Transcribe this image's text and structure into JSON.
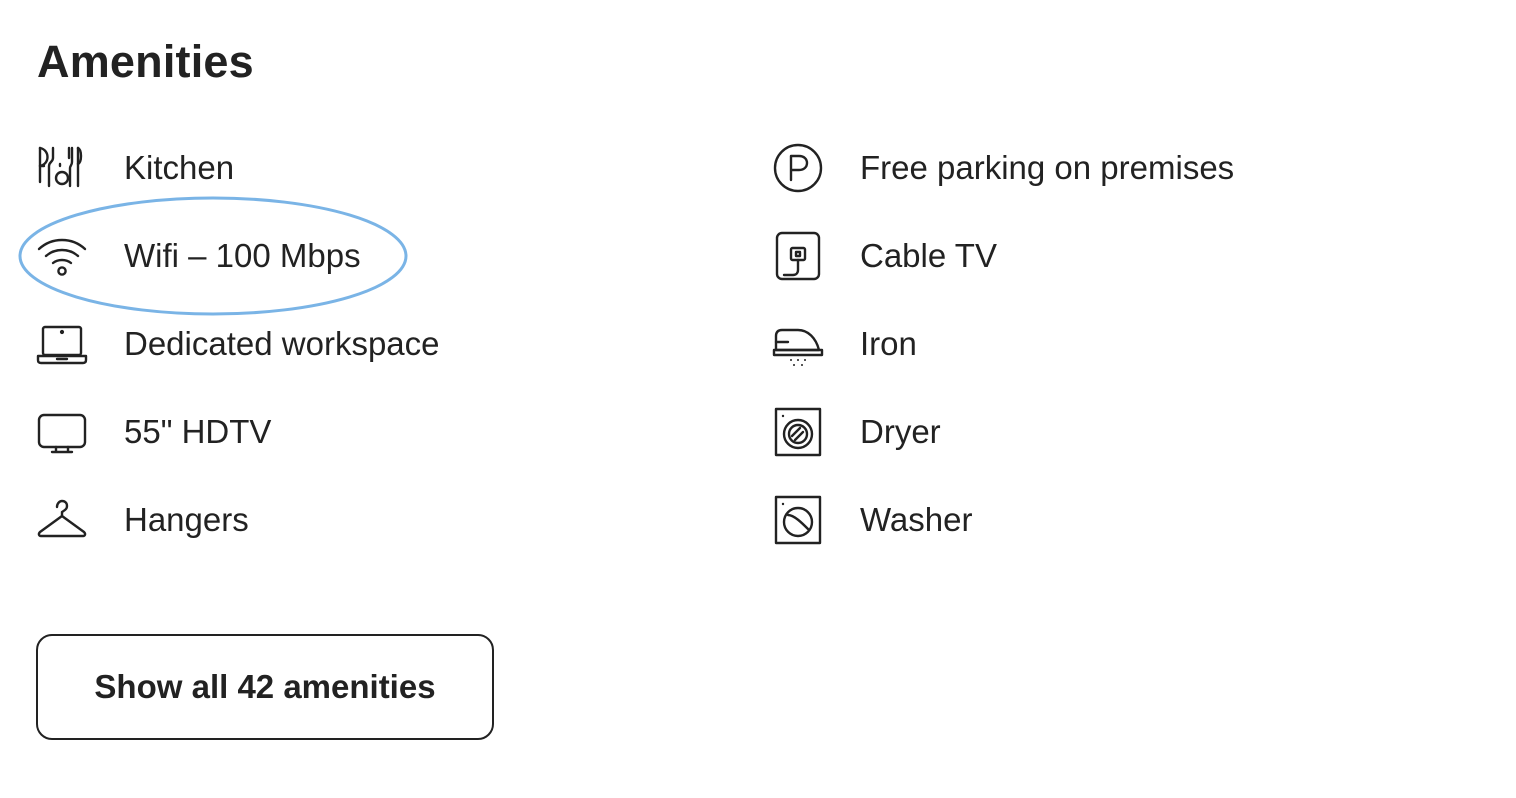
{
  "section": {
    "title": "Amenities"
  },
  "amenities": {
    "left": [
      {
        "label": "Kitchen",
        "icon": "kitchen-icon"
      },
      {
        "label": "Wifi – 100 Mbps",
        "icon": "wifi-icon"
      },
      {
        "label": "Dedicated workspace",
        "icon": "laptop-icon"
      },
      {
        "label": "55\" HDTV",
        "icon": "tv-icon"
      },
      {
        "label": "Hangers",
        "icon": "hanger-icon"
      }
    ],
    "right": [
      {
        "label": "Free parking on premises",
        "icon": "parking-icon"
      },
      {
        "label": "Cable TV",
        "icon": "cable-tv-icon"
      },
      {
        "label": "Iron",
        "icon": "iron-icon"
      },
      {
        "label": "Dryer",
        "icon": "dryer-icon"
      },
      {
        "label": "Washer",
        "icon": "washer-icon"
      }
    ]
  },
  "actions": {
    "show_all_label": "Show all 42 amenities"
  },
  "colors": {
    "text": "#222222",
    "highlight": "#7ab4e6",
    "background": "#ffffff"
  }
}
